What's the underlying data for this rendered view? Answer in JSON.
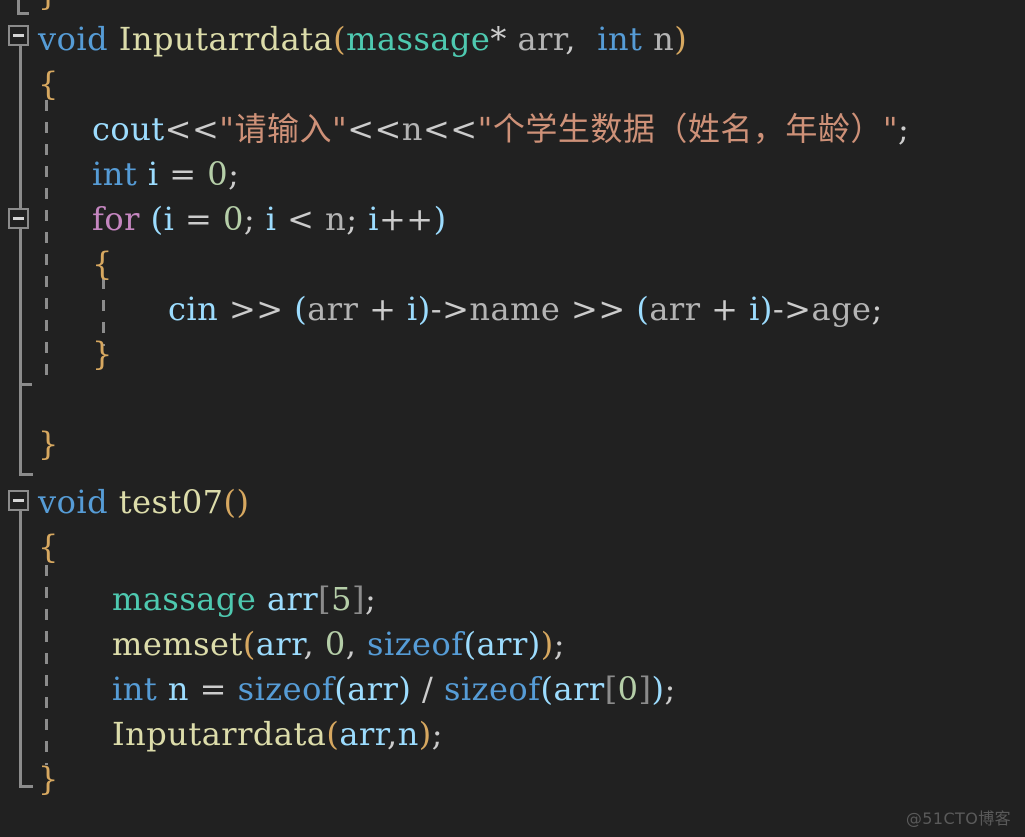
{
  "editor": {
    "background_color": "#212121",
    "default_text_color": "#d4d4d4",
    "watermark": "@51CTO博客",
    "language": "C++",
    "font_size_px": 32,
    "line_height_px": 45
  },
  "colors": {
    "keyword": "#569cd6",
    "control_keyword": "#c586c0",
    "function": "#dcdcaa",
    "type": "#4ec9b0",
    "variable": "#9cdcfe",
    "string": "#ce9178",
    "number": "#b5cea8",
    "punctuation": "#cccccc",
    "brace": "#d7a860",
    "gutter_fold": "#8c8c8c",
    "indent_guide": "#8c8c8c",
    "watermark": "#5a5a5a"
  },
  "lines": [
    {
      "n": 0,
      "text": "}"
    },
    {
      "n": 1,
      "text": "void Inputarrdata(massage* arr, int n)"
    },
    {
      "n": 2,
      "text": "{"
    },
    {
      "n": 3,
      "text": "    cout<<\"请输入\"<<n<<\"个学生数据（姓名，年龄）\";"
    },
    {
      "n": 4,
      "text": "    int i = 0;"
    },
    {
      "n": 5,
      "text": "    for (i = 0; i < n; i++)"
    },
    {
      "n": 6,
      "text": "    {"
    },
    {
      "n": 7,
      "text": "        cin >> (arr + i)->name >> (arr + i)->age;"
    },
    {
      "n": 8,
      "text": "    }"
    },
    {
      "n": 9,
      "text": ""
    },
    {
      "n": 10,
      "text": "}"
    },
    {
      "n": 11,
      "text": "void test07()"
    },
    {
      "n": 12,
      "text": "{"
    },
    {
      "n": 13,
      "text": ""
    },
    {
      "n": 14,
      "text": "     massage arr[5];"
    },
    {
      "n": 15,
      "text": "     memset(arr, 0, sizeof(arr));"
    },
    {
      "n": 16,
      "text": "     int n = sizeof(arr) / sizeof(arr[0]);"
    },
    {
      "n": 17,
      "text": "     Inputarrdata(arr,n);"
    },
    {
      "n": 18,
      "text": "}"
    }
  ],
  "tokens": {
    "kw_void": "void",
    "kw_int": "int",
    "kw_sizeof": "sizeof",
    "kw_for": "for",
    "fn_inputarrdata": "Inputarrdata",
    "fn_test07": "test07",
    "fn_memset": "memset",
    "type_massage": "massage",
    "id_arr": "arr",
    "id_n": "n",
    "id_i": "i",
    "id_cout": "cout",
    "id_cin": "cin",
    "id_name": "name",
    "id_age": "age",
    "str_prompt_1": "\"请输入\"",
    "str_prompt_2": "\"个学生数据（姓名，年龄）\"",
    "num_0": "0",
    "num_5": "5",
    "op_shift_out": "<<",
    "op_shift_in": ">>",
    "op_arrow": "->",
    "op_star": "*",
    "op_plus": "+",
    "op_assign": "=",
    "op_lt": "<",
    "op_inc": "++",
    "op_div": "/",
    "op_comma": ",",
    "op_semicolon": ";",
    "brace_open": "{",
    "brace_close": "}",
    "paren_open": "(",
    "paren_close": ")",
    "bracket_open": "[",
    "bracket_close": "]"
  },
  "folding": {
    "markers": [
      {
        "id": "fold-marker-inputarrdata",
        "state": "expanded",
        "glyph": "minus"
      },
      {
        "id": "fold-marker-for",
        "state": "expanded",
        "glyph": "minus"
      },
      {
        "id": "fold-marker-test07",
        "state": "expanded",
        "glyph": "minus"
      }
    ]
  }
}
